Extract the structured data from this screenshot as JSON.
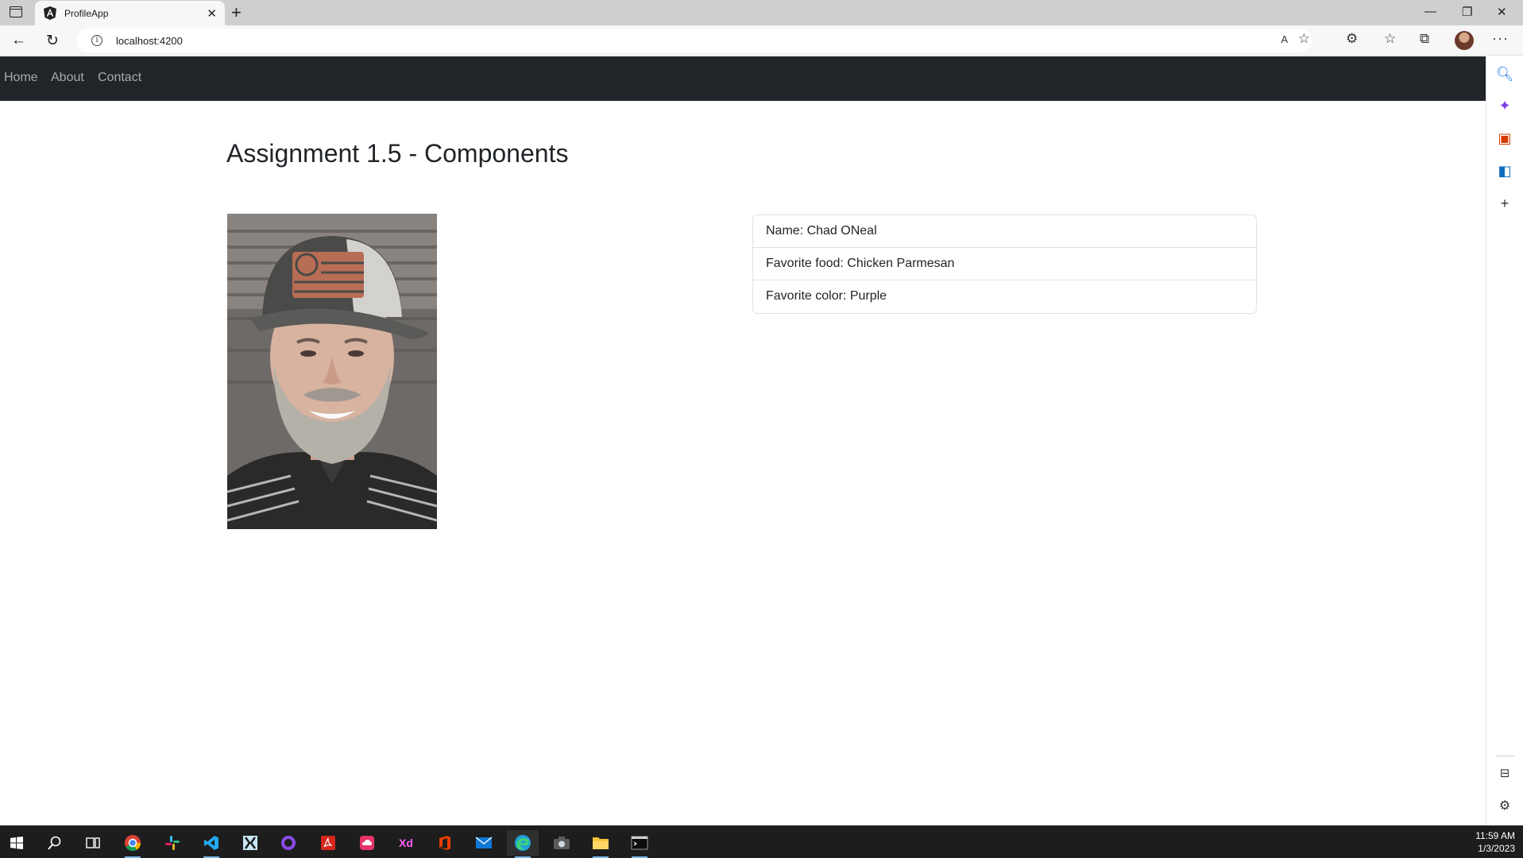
{
  "browser": {
    "tab_title": "ProfileApp",
    "url": "localhost:4200"
  },
  "navbar": {
    "links": [
      "Home",
      "About",
      "Contact"
    ]
  },
  "page": {
    "title": "Assignment 1.5 - Components"
  },
  "profile": {
    "details": [
      "Name: Chad ONeal",
      "Favorite food: Chicken Parmesan",
      "Favorite color: Purple"
    ]
  },
  "taskbar": {
    "apps": [
      "start-icon",
      "search-icon",
      "task-view-icon",
      "chrome-icon",
      "slack-icon",
      "vscode-icon",
      "xamarin-icon",
      "github-icon",
      "acrobat-icon",
      "creative-cloud-icon",
      "xd-icon",
      "office-icon",
      "mail-icon",
      "edge-icon",
      "camera-icon",
      "file-explorer-icon",
      "terminal-icon"
    ],
    "time": "11:59 AM",
    "date": "1/3/2023"
  },
  "colors": {
    "navbar_bg": "#212529",
    "nav_link": "rgba(255,255,255,0.6)",
    "taskbar_bg": "#1d1d1d"
  }
}
